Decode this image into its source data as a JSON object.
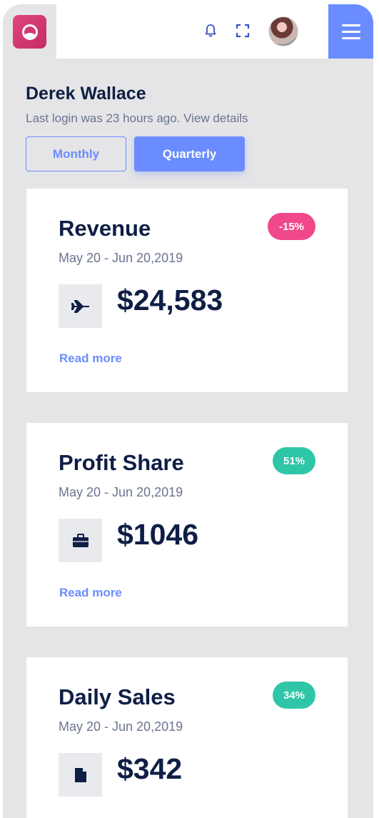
{
  "header": {
    "logo_icon": "app-logo-icon",
    "notification_icon": "bell-icon",
    "fullscreen_icon": "fullscreen-icon",
    "avatar_alt": "user avatar",
    "menu_icon": "hamburger-menu-icon"
  },
  "user": {
    "name": "Derek Wallace",
    "last_login": "Last login was 23 hours ago. View details"
  },
  "period_toggle": {
    "monthly_label": "Monthly",
    "quarterly_label": "Quarterly",
    "selected": "Quarterly"
  },
  "colors": {
    "accent": "#6a8cff",
    "negative_badge": "#f0498a",
    "positive_badge": "#2fc6a8",
    "text_dark": "#0f1e45",
    "text_muted": "#6b7490"
  },
  "cards": [
    {
      "title": "Revenue",
      "badge": "-15%",
      "badge_type": "negative",
      "date_range": "May 20 - Jun 20,2019",
      "icon": "airplane-icon",
      "value": "$24,583",
      "link": "Read more"
    },
    {
      "title": "Profit Share",
      "badge": "51%",
      "badge_type": "positive",
      "date_range": "May 20 - Jun 20,2019",
      "icon": "briefcase-icon",
      "value": "$1046",
      "link": "Read more"
    },
    {
      "title": "Daily Sales",
      "badge": "34%",
      "badge_type": "positive",
      "date_range": "May 20 - Jun 20,2019",
      "icon": "document-icon",
      "value": "$342"
    }
  ]
}
